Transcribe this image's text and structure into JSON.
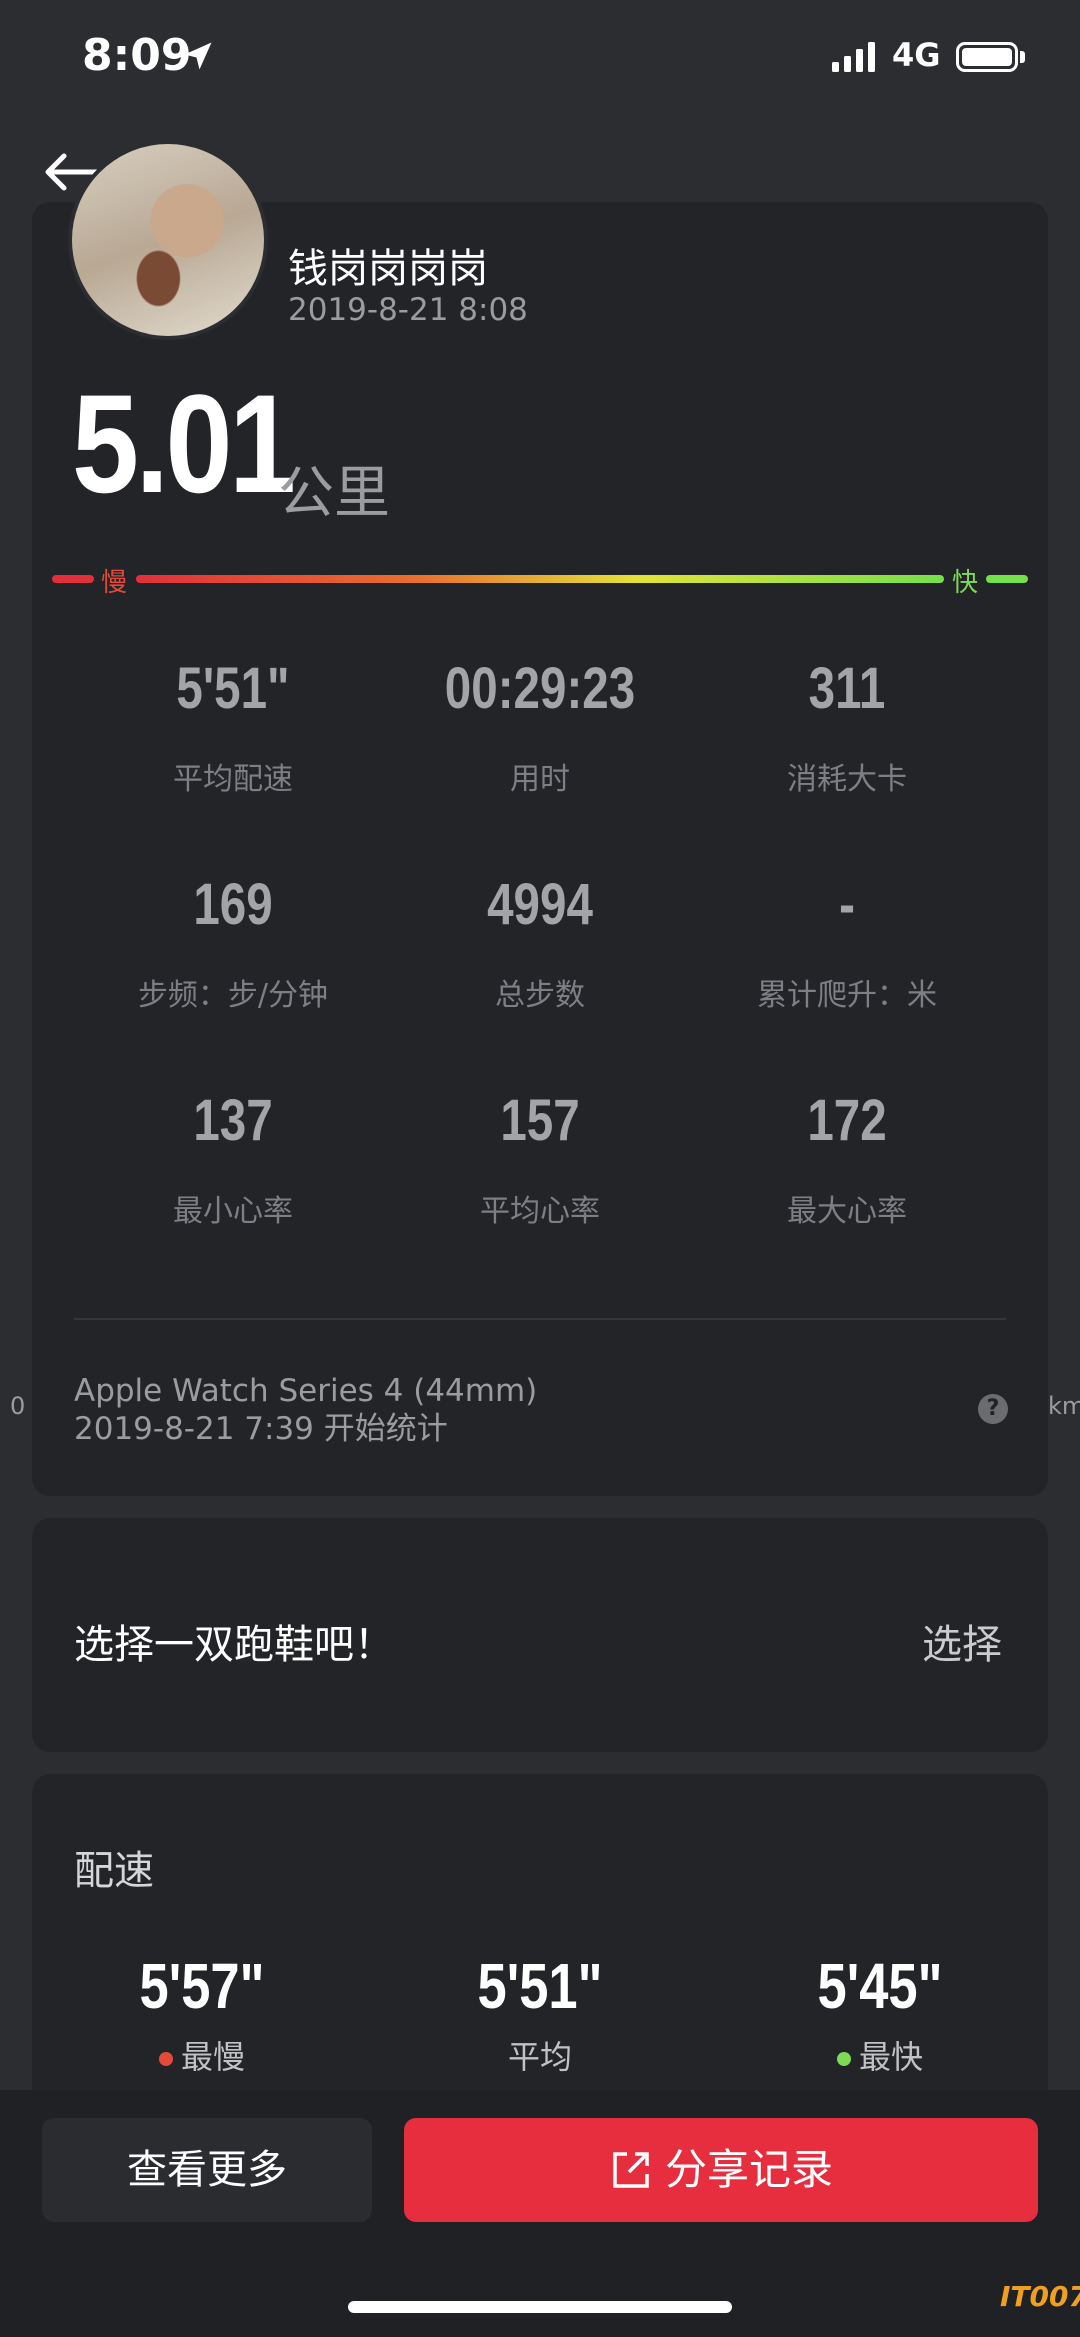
{
  "status_bar": {
    "time": "8:09",
    "network": "4G"
  },
  "profile": {
    "username": "钱岗岗岗岗",
    "datetime": "2019-8-21 8:08"
  },
  "summary": {
    "distance": "5.01",
    "distance_unit": "公里",
    "slow_label": "慢",
    "fast_label": "快"
  },
  "stats": [
    {
      "value": "5'51\"",
      "label": "平均配速"
    },
    {
      "value": "00:29:23",
      "label": "用时"
    },
    {
      "value": "311",
      "label": "消耗大卡"
    },
    {
      "value": "169",
      "label": "步频：步/分钟"
    },
    {
      "value": "4994",
      "label": "总步数"
    },
    {
      "value": "-",
      "label": "累计爬升：米"
    },
    {
      "value": "137",
      "label": "最小心率"
    },
    {
      "value": "157",
      "label": "平均心率"
    },
    {
      "value": "172",
      "label": "最大心率"
    }
  ],
  "device": {
    "name": "Apple Watch Series 4 (44mm)",
    "start": "2019-8-21 7:39 开始统计",
    "edge_left": "0",
    "edge_right": "km"
  },
  "shoe": {
    "prompt": "选择一双跑鞋吧！",
    "button": "选择"
  },
  "pace": {
    "title": "配速",
    "slowest": {
      "value": "5'57\"",
      "label": "最慢"
    },
    "average": {
      "value": "5'51\"",
      "label": "平均"
    },
    "fastest": {
      "value": "5'45\"",
      "label": "最快"
    }
  },
  "actions": {
    "more": "查看更多",
    "share": "分享记录"
  },
  "watermark": "IT007",
  "colors": {
    "background": "#2b2d31",
    "card": "#222428",
    "accent_red": "#e62e3f",
    "slow_red": "#e24a3a",
    "fast_green": "#7ed957"
  }
}
